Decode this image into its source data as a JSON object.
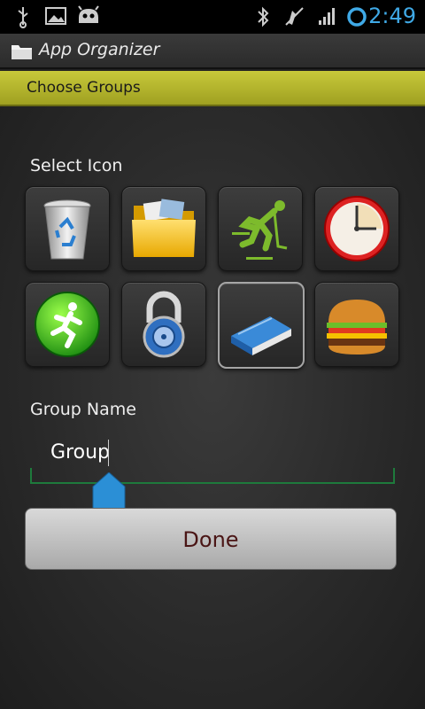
{
  "status_bar": {
    "time": "2:49",
    "icons": [
      "usb-icon",
      "picture-icon",
      "android-icon",
      "bluetooth-icon",
      "mute-icon",
      "signal-icon",
      "sync-circle-icon"
    ]
  },
  "title_bar": {
    "title": "App Organizer",
    "icon": "folder-icon"
  },
  "section_bar": {
    "label": "Choose Groups"
  },
  "select_icon": {
    "heading": "Select Icon",
    "icons": [
      {
        "name": "recycle-bin-icon",
        "selected": false
      },
      {
        "name": "folder-icon",
        "selected": false
      },
      {
        "name": "hockey-player-icon",
        "selected": false
      },
      {
        "name": "clock-icon",
        "selected": false
      },
      {
        "name": "runner-icon",
        "selected": false
      },
      {
        "name": "padlock-icon",
        "selected": false
      },
      {
        "name": "book-icon",
        "selected": true
      },
      {
        "name": "burger-icon",
        "selected": false
      }
    ]
  },
  "group_name": {
    "heading": "Group Name",
    "value": "Group"
  },
  "done_button": {
    "label": "Done"
  },
  "colors": {
    "accent_time": "#3fa9e6",
    "section_bar": "#b6b72e",
    "underline": "#1e7a3c",
    "handle": "#2b8fd6"
  }
}
